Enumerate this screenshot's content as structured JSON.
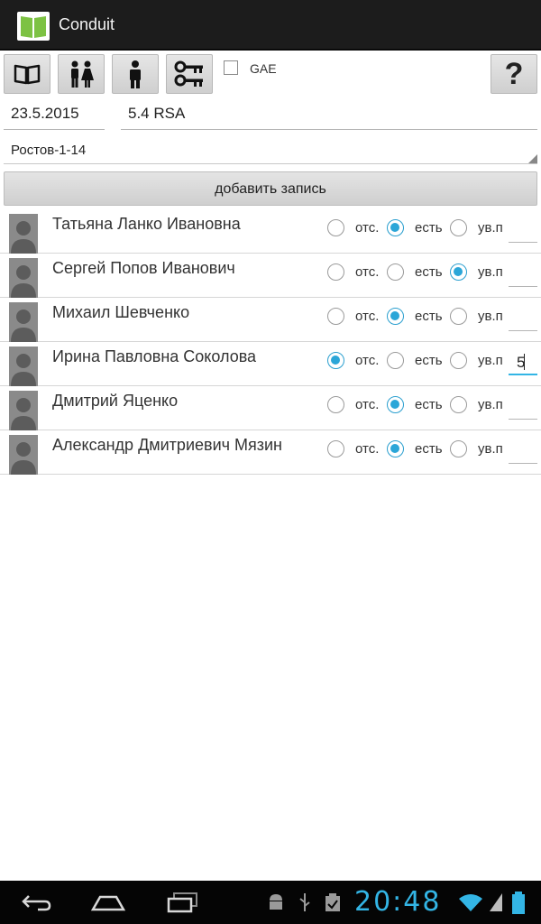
{
  "app": {
    "title": "Conduit"
  },
  "toolbar": {
    "gae_label": "GAE",
    "gae_checked": false,
    "help_label": "?"
  },
  "form": {
    "date": "23.5.2015",
    "class": "5.4 RSA",
    "group": "Ростов-1-14"
  },
  "add_button_label": "добавить запись",
  "attendance_labels": {
    "absent": "отс.",
    "present": "есть",
    "excused": "ув.п"
  },
  "students": [
    {
      "name": "Татьяна Ланко Ивановна",
      "status": "present",
      "grade": ""
    },
    {
      "name": "Сергей Попов Иванович",
      "status": "excused",
      "grade": ""
    },
    {
      "name": "Михаил Шевченко",
      "status": "present",
      "grade": ""
    },
    {
      "name": "Ирина Павловна Соколова",
      "status": "absent",
      "grade": "5"
    },
    {
      "name": "Дмитрий Яценко",
      "status": "present",
      "grade": ""
    },
    {
      "name": "Александр Дмитриевич Мязин",
      "status": "present",
      "grade": ""
    }
  ],
  "system": {
    "clock": "20:48"
  },
  "colors": {
    "accent": "#33b5e5",
    "actionbar": "#1c1c1c",
    "navbar": "#050505"
  }
}
